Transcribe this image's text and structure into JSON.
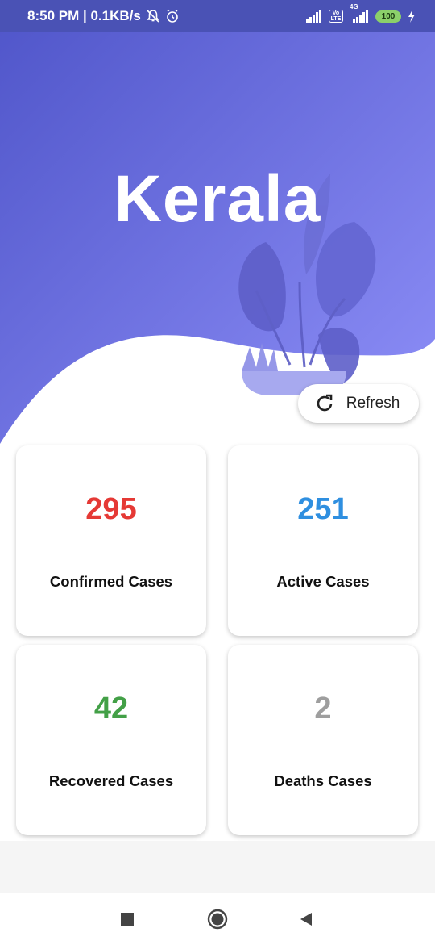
{
  "status_bar": {
    "time_speed": "8:50 PM | 0.1KB/s",
    "volte_top": "Vo",
    "volte_bottom": "LTE",
    "net_type": "4G",
    "battery": "100"
  },
  "page": {
    "title": "Kerala"
  },
  "refresh": {
    "label": "Refresh"
  },
  "stats": [
    {
      "value": "295",
      "label": "Confirmed Cases",
      "color": "#e53935"
    },
    {
      "value": "251",
      "label": "Active Cases",
      "color": "#2f8fe0"
    },
    {
      "value": "42",
      "label": "Recovered Cases",
      "color": "#43a047"
    },
    {
      "value": "2",
      "label": "Deaths Cases",
      "color": "#9e9e9e"
    }
  ],
  "colors": {
    "hero_gradient_start": "#4f55c9",
    "hero_gradient_end": "#8e8ff8",
    "status_bar": "#4a52b5"
  },
  "icons": {
    "refresh": "refresh-icon",
    "nav_recents": "square-icon",
    "nav_home": "circle-icon",
    "nav_back": "triangle-back-icon",
    "plant": "plant-illustration"
  }
}
